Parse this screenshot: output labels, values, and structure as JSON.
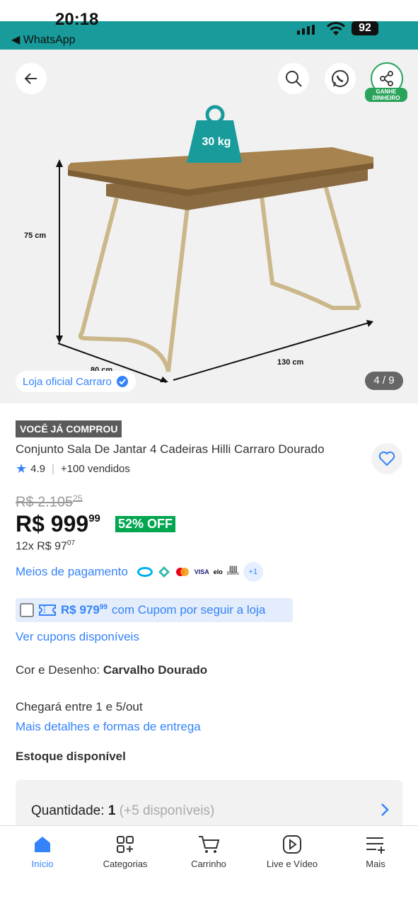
{
  "status_bar": {
    "time": "20:18",
    "back_app": "◀ WhatsApp",
    "battery": "92"
  },
  "hero": {
    "weight_label": "30 kg",
    "height_label": "75 cm",
    "width_label": "130 cm",
    "depth_label": "80 cm",
    "share_caption": "GANHE DINHEIRO",
    "store_pill": "Loja oficial Carraro",
    "image_counter": "4 / 9"
  },
  "product": {
    "badge": "VOCÊ JÁ COMPROU",
    "title": "Conjunto Sala De Jantar 4 Cadeiras Hilli Carraro Dourado",
    "rating": "4.9",
    "sold": "+100 vendidos",
    "old_price_main": "R$ 2.105",
    "old_price_cents": "25",
    "price_main": "R$ 999",
    "price_cents": "99",
    "discount": "52% OFF",
    "installments_main": "12x R$ 97",
    "installments_cents": "07",
    "payments_label": "Meios de pagamento",
    "payment_more": "+1",
    "payment_visa": "VISA",
    "payment_elo": "elo",
    "payment_boleto": "Boleto",
    "coupon_price_main": "R$ 979",
    "coupon_price_cents": "99",
    "coupon_text": "com Cupom por seguir a loja",
    "see_coupons": "Ver cupons disponíveis",
    "color_label": "Cor e Desenho:",
    "color_value": "Carvalho Dourado",
    "arrival": "Chegará entre 1 e 5/out",
    "delivery_link": "Mais detalhes e formas de entrega",
    "stock": "Estoque disponível",
    "quantity_label": "Quantidade:",
    "quantity_value": "1",
    "quantity_available": "(+5 disponíveis)"
  },
  "nav": [
    {
      "label": "Início"
    },
    {
      "label": "Categorias"
    },
    {
      "label": "Carrinho"
    },
    {
      "label": "Live e Vídeo"
    },
    {
      "label": "Mais"
    }
  ],
  "colors": {
    "accent_blue": "#3483fa",
    "teal": "#189b9a",
    "green": "#00a650"
  }
}
